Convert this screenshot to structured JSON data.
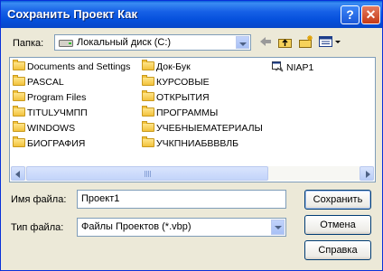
{
  "window": {
    "title": "Сохранить Проект Как",
    "help": "?",
    "close": "✕"
  },
  "folder_label": "Папка:",
  "folder_value": "Локальный диск (C:)",
  "files_col1": [
    "Documents and Settings",
    "PASCAL",
    "Program Files",
    "TITULУЧМПП",
    "WINDOWS",
    "БИОГРАФИЯ"
  ],
  "files_col2": [
    "Док-Бук",
    "КУРСОВЫЕ",
    "ОТКРЫТИЯ",
    "ПРОГРАММЫ",
    "УЧЕБНЫЕМАТЕРИАЛЫ",
    "УЧКПНИАБВВВЛБ"
  ],
  "files_col3": [
    "NIAP1"
  ],
  "filename_label": "Имя файла:",
  "filename_value": "Проект1",
  "filetype_label": "Тип файла:",
  "filetype_value": "Файлы Проектов (*.vbp)",
  "buttons": {
    "save": "Сохранить",
    "cancel": "Отмена",
    "help": "Справка"
  },
  "icons": [
    "drive-icon",
    "back-icon",
    "up-folder-icon",
    "new-folder-icon",
    "view-menu-icon",
    "folder-icon",
    "vb-project-icon"
  ]
}
